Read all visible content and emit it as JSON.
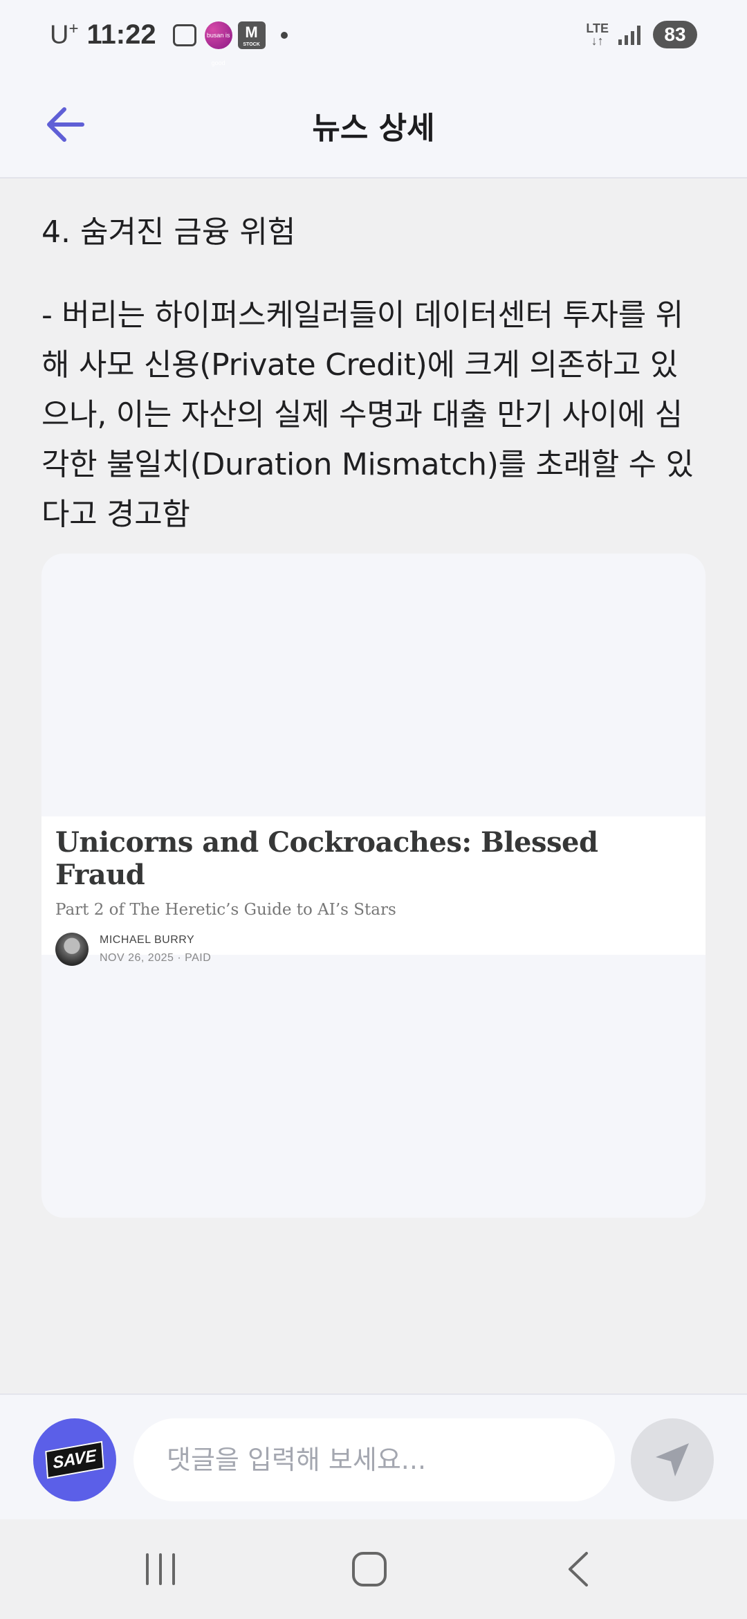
{
  "status_bar": {
    "carrier": "U",
    "carrier_plus": "+",
    "time": "11:22",
    "busan_badge": "busan is good",
    "m_badge": "M",
    "m_badge_sub": "STOCK",
    "network": "LTE",
    "battery": "83"
  },
  "header": {
    "title": "뉴스 상세"
  },
  "article": {
    "section_heading": "4. 숨겨진 금융 위험",
    "body": "- 버리는 하이퍼스케일러들이 데이터센터 투자를 위해 사모 신용(Private Credit)에 크게 의존하고 있으나, 이는 자산의 실제 수명과 대출 만기 사이에 심각한 불일치(Duration Mismatch)를 초래할 수 있다고 경고함"
  },
  "embed": {
    "title": "Unicorns and Cockroaches: Blessed Fraud",
    "subtitle": "Part 2 of The Heretic’s Guide to AI’s Stars",
    "author": "MICHAEL BURRY",
    "meta": "NOV 26, 2025 · PAID"
  },
  "comment_bar": {
    "save_label": "SAVE",
    "placeholder": "댓글을 입력해 보세요..."
  },
  "colors": {
    "accent": "#5b5fe8",
    "back_arrow": "#5f5fd6",
    "background": "#f0f0f1"
  },
  "icons": {
    "back": "arrow-left-icon",
    "send": "paper-plane-icon",
    "nav_recents": "recents-icon",
    "nav_home": "home-icon",
    "nav_back": "chevron-left-icon"
  }
}
